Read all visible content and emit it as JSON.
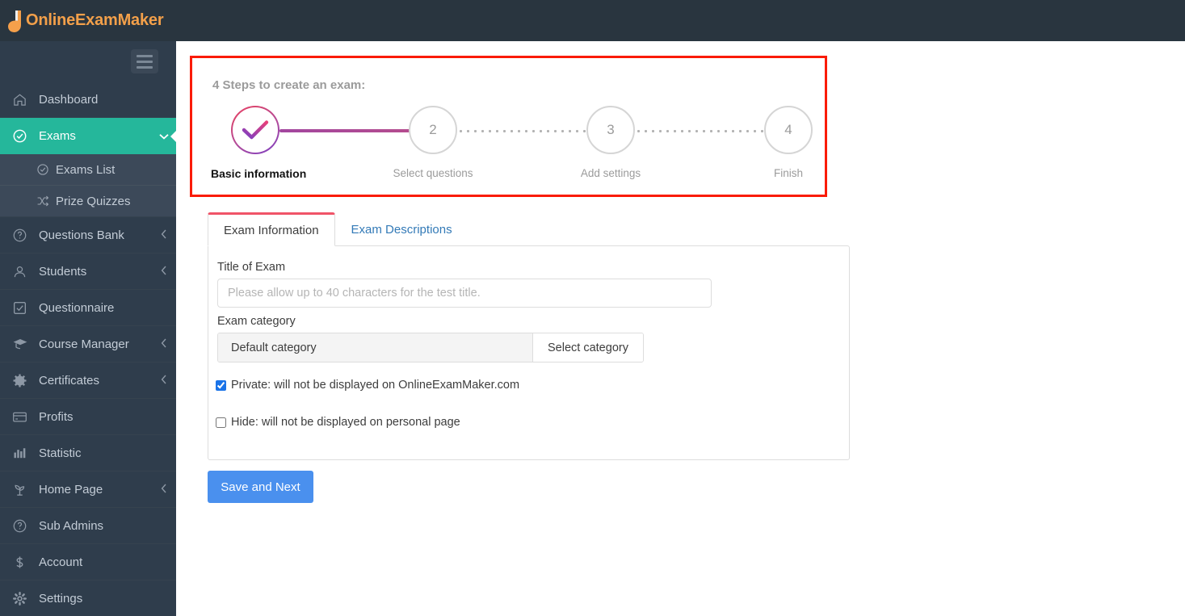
{
  "brand": {
    "name": "OnlineExamMaker",
    "logo_icon": "leaf-flame-icon",
    "accent_color": "#f3a04a"
  },
  "sidebar": {
    "menu_toggle_icon": "hamburger-icon",
    "items": [
      {
        "label": "Dashboard",
        "icon": "home-icon",
        "active": false,
        "caret": ""
      },
      {
        "label": "Exams",
        "icon": "check-circle-icon",
        "active": true,
        "caret": "chevron-down-icon"
      },
      {
        "label": "Questions Bank",
        "icon": "question-circle-icon",
        "active": false,
        "caret": "chevron-left-icon"
      },
      {
        "label": "Students",
        "icon": "user-icon",
        "active": false,
        "caret": "chevron-left-icon"
      },
      {
        "label": "Questionnaire",
        "icon": "checkbox-icon",
        "active": false,
        "caret": ""
      },
      {
        "label": "Course Manager",
        "icon": "graduation-cap-icon",
        "active": false,
        "caret": "chevron-left-icon"
      },
      {
        "label": "Certificates",
        "icon": "badge-icon",
        "active": false,
        "caret": "chevron-left-icon"
      },
      {
        "label": "Profits",
        "icon": "credit-card-icon",
        "active": false,
        "caret": ""
      },
      {
        "label": "Statistic",
        "icon": "bar-chart-icon",
        "active": false,
        "caret": ""
      },
      {
        "label": "Home Page",
        "icon": "plant-icon",
        "active": false,
        "caret": "chevron-left-icon"
      },
      {
        "label": "Sub Admins",
        "icon": "question-circle-icon",
        "active": false,
        "caret": ""
      },
      {
        "label": "Account",
        "icon": "dollar-icon",
        "active": false,
        "caret": ""
      },
      {
        "label": "Settings",
        "icon": "gear-icon",
        "active": false,
        "caret": ""
      }
    ],
    "submenu": [
      {
        "label": "Exams List",
        "icon": "check-circle-icon"
      },
      {
        "label": "Prize Quizzes",
        "icon": "shuffle-icon"
      }
    ],
    "active_color": "#25b79b",
    "background_color": "#2f3d4c"
  },
  "steps": {
    "title": "4 Steps to create an exam:",
    "highlight_color": "#fa1b05",
    "items": [
      {
        "number": "1",
        "label": "Basic information",
        "state": "completed",
        "marker": "check-icon"
      },
      {
        "number": "2",
        "label": "Select questions",
        "state": "pending",
        "marker": "2"
      },
      {
        "number": "3",
        "label": "Add settings",
        "state": "pending",
        "marker": "3"
      },
      {
        "number": "4",
        "label": "Finish",
        "state": "pending",
        "marker": "4"
      }
    ]
  },
  "tabs": [
    {
      "label": "Exam Information",
      "active": true
    },
    {
      "label": "Exam Descriptions",
      "active": false
    }
  ],
  "form": {
    "title_label": "Title of Exam",
    "title_value": "",
    "title_placeholder": "Please allow up to 40 characters for the test title.",
    "category_label": "Exam category",
    "category_value": "Default category",
    "category_button": "Select category",
    "private_label": "Private: will not be displayed on OnlineExamMaker.com",
    "private_checked": true,
    "hide_label": "Hide: will not be displayed on personal page",
    "hide_checked": false
  },
  "actions": {
    "save_next": "Save and Next",
    "primary_color": "#4a90ee"
  }
}
